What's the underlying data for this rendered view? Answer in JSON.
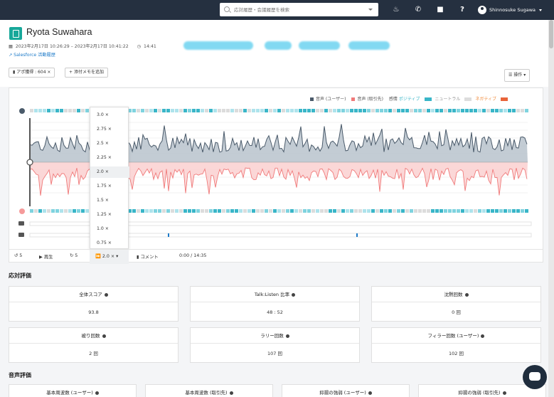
{
  "topbar": {
    "search_placeholder": "応対履歴・会議履歴を検索",
    "user_name": "Shinnosuke Sugawa",
    "icons": [
      "bell-icon",
      "phone-icon",
      "car-icon",
      "help-icon"
    ]
  },
  "header": {
    "title": "Ryota Suwahara",
    "datetime": "2023年2月17日 10:26:29 – 2023年2月17日 10:41:22",
    "duration": "14:41",
    "salesforce_link": "Salesforce 活動履歴"
  },
  "actions": {
    "tag_chip": "アポ獲得 : 604",
    "add_memo": "添付メモを追加",
    "operations": "操作"
  },
  "legend": {
    "voice_user": "音声 (ユーザー)",
    "voice_customer": "音声 (取引先)",
    "emotion": "感情",
    "positive": "ポジティブ",
    "neutral": "ニュートラル",
    "negative": "ネガティブ"
  },
  "speed_menu": {
    "options": [
      "3.0 ×",
      "2.75 ×",
      "2.5 ×",
      "2.25 ×",
      "2.0 ×",
      "1.75 ×",
      "1.5 ×",
      "1.25 ×",
      "1.0 ×",
      "0.75 ×"
    ],
    "selected": "2.0 ×"
  },
  "controls": {
    "back": "5",
    "play": "再生",
    "forward": "5",
    "speed": "2.0 ×",
    "comment": "コメント",
    "time": "0:00 / 14:35"
  },
  "response_eval": {
    "title": "応対評価",
    "metrics": [
      {
        "label": "全体スコア",
        "value": "93.8"
      },
      {
        "label": "Talk:Listen 比率",
        "value": "48 : 52"
      },
      {
        "label": "沈黙回数",
        "value": "0 回"
      },
      {
        "label": "被り回数",
        "value": "2 回"
      },
      {
        "label": "ラリー回数",
        "value": "107 回"
      },
      {
        "label": "フィラー回数 (ユーザー)",
        "value": "102 回"
      }
    ]
  },
  "voice_eval": {
    "title": "音声評価",
    "metrics": [
      {
        "label": "基本周波数 (ユーザー)"
      },
      {
        "label": "基本周波数 (取引先)"
      },
      {
        "label": "抑揚の強弱 (ユーザー)"
      },
      {
        "label": "抑揚の強弱 (取引先)"
      }
    ]
  },
  "colors": {
    "topbar": "#253040",
    "user_wave": "#4a5a6a",
    "customer_wave": "#f07a7a",
    "positive": "#39b6c8",
    "accent_link": "#1e7bc9"
  }
}
